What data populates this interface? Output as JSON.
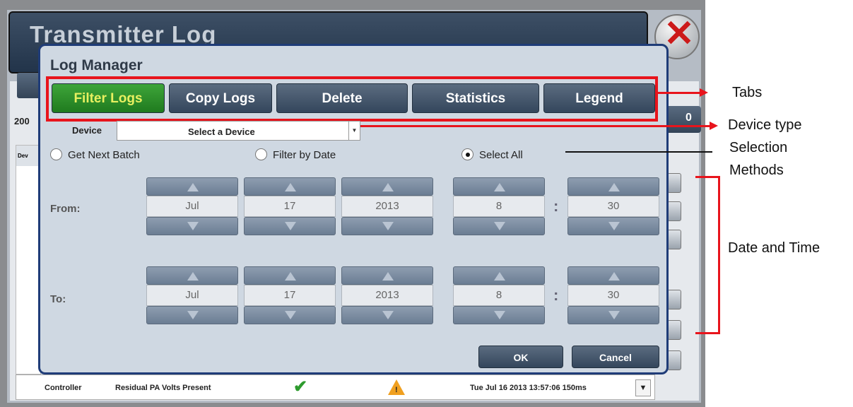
{
  "window": {
    "title": "Transmitter Log"
  },
  "background": {
    "year_fragment": "200",
    "count_fragment": "0",
    "table_header": "Dev",
    "bottom_row": {
      "device": "Controller",
      "event": "Residual PA Volts Present",
      "status_icon": "check-icon",
      "alarm_icon": "warning-icon",
      "timestamp": "Tue Jul 16 2013 13:57:06 150ms"
    }
  },
  "dialog": {
    "title": "Log Manager",
    "tabs": [
      {
        "label": "Filter Logs",
        "active": true
      },
      {
        "label": "Copy Logs",
        "active": false
      },
      {
        "label": "Delete",
        "active": false
      },
      {
        "label": "Statistics",
        "active": false
      },
      {
        "label": "Legend",
        "active": false
      }
    ],
    "device": {
      "label": "Device",
      "value": "Select a Device"
    },
    "selection_methods": [
      {
        "label": "Get Next Batch",
        "selected": false
      },
      {
        "label": "Filter by Date",
        "selected": false
      },
      {
        "label": "Select All",
        "selected": true
      }
    ],
    "from": {
      "label": "From:",
      "month": "Jul",
      "day": "17",
      "year": "2013",
      "hour": "8",
      "minute": "30"
    },
    "to": {
      "label": "To:",
      "month": "Jul",
      "day": "17",
      "year": "2013",
      "hour": "8",
      "minute": "30"
    },
    "time_separator": ":",
    "buttons": {
      "ok": "OK",
      "cancel": "Cancel"
    }
  },
  "annotations": {
    "tabs": "Tabs",
    "device_type": "Device type",
    "selection_methods_line1": "Selection",
    "selection_methods_line2": "Methods",
    "date_time": "Date and Time"
  },
  "colors": {
    "annotation_red": "#e8141c",
    "active_tab": "#3ea53a",
    "dialog_border": "#1f3c78"
  }
}
